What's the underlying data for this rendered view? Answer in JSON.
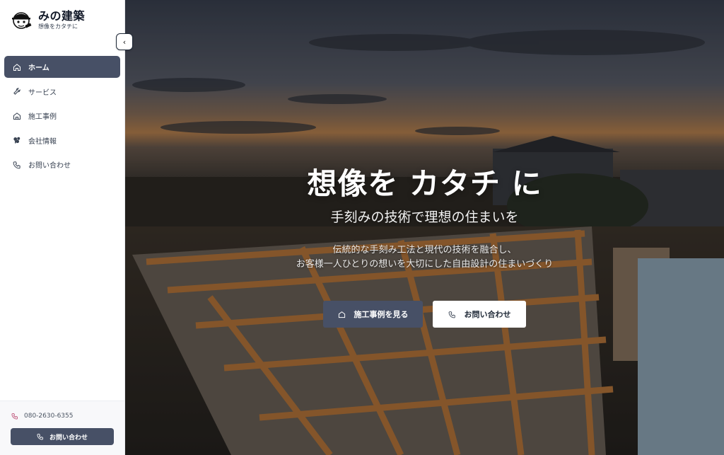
{
  "brand": {
    "name": "みの建築",
    "tagline": "想像をカタチに"
  },
  "nav": [
    {
      "label": "ホーム",
      "icon": "home-icon",
      "active": true
    },
    {
      "label": "サービス",
      "icon": "wrench-icon"
    },
    {
      "label": "施工事例",
      "icon": "house-icon"
    },
    {
      "label": "会社情報",
      "icon": "building-icon"
    },
    {
      "label": "お問い合わせ",
      "icon": "phone-icon"
    }
  ],
  "footer": {
    "phone": "080-2630-6355",
    "contact_label": "お問い合わせ"
  },
  "hero": {
    "title": "想像を カタチ に",
    "subtitle": "手刻みの技術で理想の住まいを",
    "desc_line1": "伝統的な手刻み工法と現代の技術を融合し、",
    "desc_line2": "お客様一人ひとりの想いを大切にした自由設計の住まいづくり",
    "primary_button": "施工事例を見る",
    "secondary_button": "お問い合わせ"
  },
  "colors": {
    "accent": "#475066",
    "sidebar_bg": "#ffffff",
    "phone_icon": "#c0567b"
  }
}
